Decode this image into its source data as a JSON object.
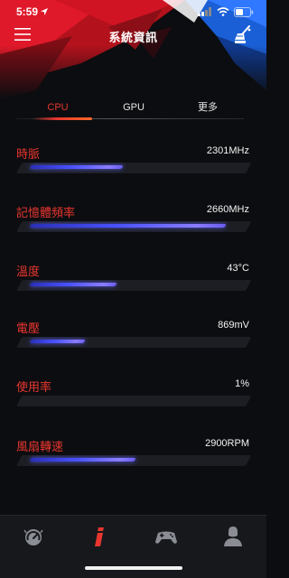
{
  "status_bar": {
    "time": "5:59"
  },
  "header": {
    "title": "系統資訊"
  },
  "tabs": [
    {
      "label": "CPU",
      "active": true
    },
    {
      "label": "GPU",
      "active": false
    },
    {
      "label": "更多",
      "active": false
    }
  ],
  "metrics": [
    {
      "label": "時脈",
      "value": "2301MHz",
      "level": 0.44
    },
    {
      "label": "記憶體頻率",
      "value": "2660MHz",
      "level": 0.93
    },
    {
      "label": "溫度",
      "value": "43°C",
      "level": 0.41
    },
    {
      "label": "電壓",
      "value": "869mV",
      "level": 0.26
    },
    {
      "label": "使用率",
      "value": "1%",
      "level": 0.0
    },
    {
      "label": "風扇轉速",
      "value": "2900RPM",
      "level": 0.5
    }
  ],
  "bottom_nav": [
    {
      "icon": "speedometer-icon",
      "active": false
    },
    {
      "icon": "system-info-icon",
      "active": true
    },
    {
      "icon": "gamepad-icon",
      "active": false
    },
    {
      "icon": "user-icon",
      "active": false
    }
  ],
  "colors": {
    "accent_red": "#e8362f",
    "bar_blue": "#4a52ff",
    "background": "#0c0d10"
  }
}
